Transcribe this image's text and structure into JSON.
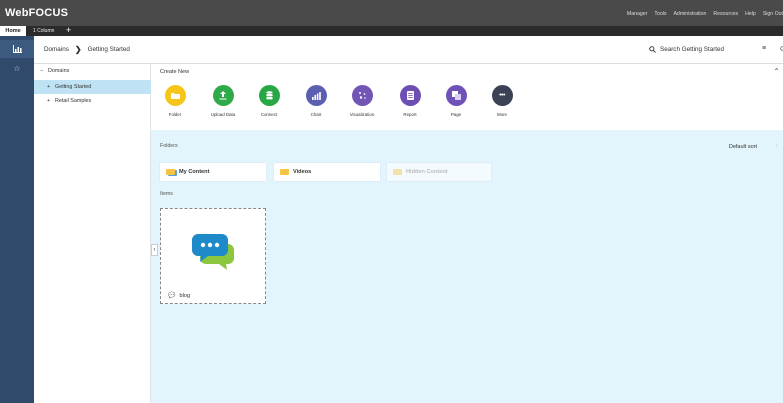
{
  "app": {
    "logo": "WebFOCUS"
  },
  "top_menu": [
    "Manager",
    "Tools",
    "Administration",
    "Resources",
    "Help",
    "Sign Out"
  ],
  "tabs": {
    "home": "Home",
    "column": "1 Column",
    "add": "+"
  },
  "left_nav": [
    {
      "icon": "chart-icon"
    },
    {
      "icon": "star-icon"
    }
  ],
  "breadcrumb": {
    "root": "Domains",
    "separator": "❯",
    "current": "Getting Started"
  },
  "search": {
    "label": "Search Getting Started"
  },
  "tree": {
    "root": {
      "toggle": "−",
      "label": "Domains"
    },
    "items": [
      {
        "toggle": "+",
        "label": "Getting Started",
        "selected": true
      },
      {
        "toggle": "+",
        "label": "Retail Samples",
        "selected": false
      }
    ]
  },
  "create_new": {
    "title": "Create New",
    "items": [
      {
        "label": "Folder",
        "color": "#f5c518",
        "icon": "folder-icon"
      },
      {
        "label": "Upload Data",
        "color": "#2eaa4a",
        "icon": "upload-icon"
      },
      {
        "label": "Connect",
        "color": "#28a745",
        "icon": "database-icon"
      },
      {
        "label": "Chart",
        "color": "#5a5fb0",
        "icon": "bar-chart-icon"
      },
      {
        "label": "Visualization",
        "color": "#7156b5",
        "icon": "scatter-icon"
      },
      {
        "label": "Report",
        "color": "#6d4fb3",
        "icon": "report-icon"
      },
      {
        "label": "Page",
        "color": "#6e52b8",
        "icon": "page-icon"
      },
      {
        "label": "More",
        "color": "#3b4254",
        "icon": "more-icon"
      }
    ]
  },
  "folders": {
    "title": "Folders",
    "sort_label": "Default sort",
    "sort_arrow": "↑",
    "items": [
      {
        "label": "My Content",
        "faded": false
      },
      {
        "label": "Videos",
        "faded": false
      },
      {
        "label": "Hidden Content",
        "faded": true
      }
    ]
  },
  "items_section": {
    "title": "Items",
    "cards": [
      {
        "label": "blog",
        "icon": "chat-bubbles-icon"
      }
    ]
  },
  "colors": {
    "topbar": "#4a4a4a",
    "leftnav": "#2f4a6b",
    "main_bg": "#e2f4fc",
    "selected_row": "#bfe3f5"
  }
}
